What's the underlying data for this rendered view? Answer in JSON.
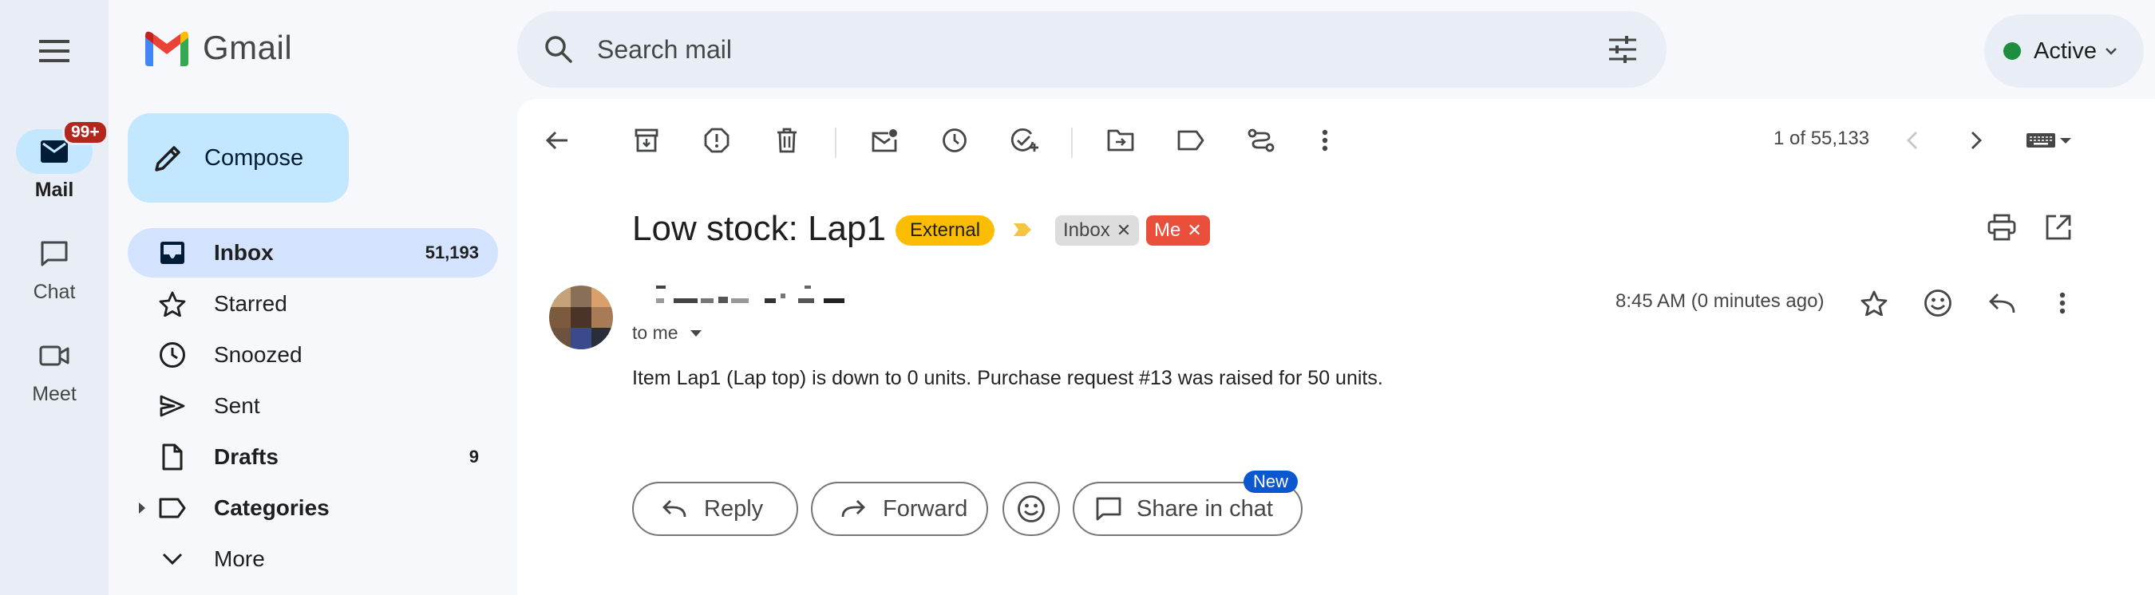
{
  "app": {
    "name": "Gmail",
    "brand_color": "#ea4335"
  },
  "rail": {
    "items": [
      {
        "label": "Mail",
        "badge": "99+",
        "icon": "mail-icon",
        "active": true
      },
      {
        "label": "Chat",
        "icon": "chat-icon"
      },
      {
        "label": "Meet",
        "icon": "video-icon"
      }
    ]
  },
  "compose": {
    "label": "Compose"
  },
  "nav": {
    "items": [
      {
        "label": "Inbox",
        "count": "51,193",
        "icon": "inbox-icon"
      },
      {
        "label": "Starred",
        "count": "",
        "icon": "star-icon"
      },
      {
        "label": "Snoozed",
        "count": "",
        "icon": "clock-icon"
      },
      {
        "label": "Sent",
        "count": "",
        "icon": "send-icon"
      },
      {
        "label": "Drafts",
        "count": "9",
        "icon": "draft-icon"
      },
      {
        "label": "Categories",
        "count": "",
        "icon": "label-icon"
      },
      {
        "label": "More",
        "count": "",
        "icon": "chevron-down-icon"
      }
    ]
  },
  "search": {
    "placeholder": "Search mail"
  },
  "status": {
    "label": "Active",
    "color": "#1e8e3e"
  },
  "toolbar": {
    "pager_text": "1 of 55,133"
  },
  "email": {
    "subject": "Low stock: Lap1",
    "labels": {
      "external": "External",
      "inbox": "Inbox",
      "me": "Me"
    },
    "recipient": "to me",
    "time": "8:45 AM (0 minutes ago)",
    "body": "Item Lap1 (Lap top) is down to 0 units. Purchase request #13 was raised for 50 units."
  },
  "actions": {
    "reply": "Reply",
    "forward": "Forward",
    "share": "Share in chat",
    "new_badge": "New"
  }
}
